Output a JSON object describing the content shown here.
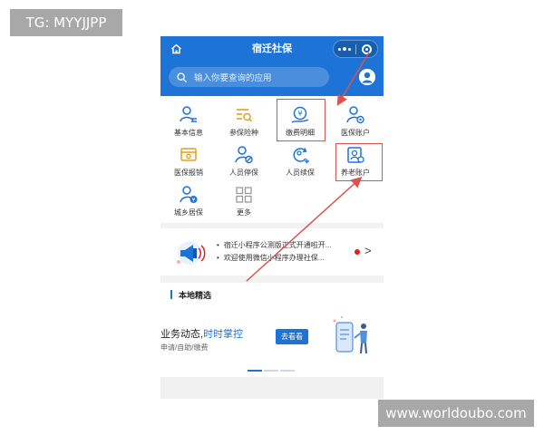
{
  "watermarks": {
    "top_left": "TG: MYYJJPP",
    "bottom_right": "www.worldoubo.com"
  },
  "header": {
    "title": "宿迁社保",
    "search_placeholder": "输入你要查询的应用",
    "icons": [
      "home-icon",
      "more-icon",
      "close-icon",
      "search-icon",
      "avatar-icon"
    ]
  },
  "grid": {
    "items": [
      {
        "label": "基本信息",
        "icon": "person-card-icon",
        "color": "#1d73d6"
      },
      {
        "label": "参保险种",
        "icon": "list-search-icon",
        "color": "#e0a020"
      },
      {
        "label": "缴费明细",
        "icon": "yuan-coin-icon",
        "color": "#1d73d6"
      },
      {
        "label": "医保账户",
        "icon": "person-shield-icon",
        "color": "#1d73d6"
      },
      {
        "label": "医保报销",
        "icon": "wallet-card-icon",
        "color": "#e0a020"
      },
      {
        "label": "人员停保",
        "icon": "person-stop-icon",
        "color": "#1d73d6"
      },
      {
        "label": "人员续保",
        "icon": "person-renew-icon",
        "color": "#1d73d6"
      },
      {
        "label": "养老账户",
        "icon": "person-account-icon",
        "color": "#1d73d6"
      },
      {
        "label": "城乡居保",
        "icon": "person-money-icon",
        "color": "#1d73d6"
      },
      {
        "label": "更多",
        "icon": "grid-more-icon",
        "color": "#999999"
      }
    ]
  },
  "notice": {
    "lines": [
      "宿迁小程序公测版正式开通啦开...",
      "欢迎使用微信小程序办理社保..."
    ],
    "chevron": ">",
    "icon": "megaphone-icon"
  },
  "local": {
    "section_title": "本地精选",
    "banner_title_prefix": "业务动态,",
    "banner_title_accent": "时时掌控",
    "banner_subtitle": "申请/自助/缴费",
    "banner_button": "去看看"
  },
  "colors": {
    "primary": "#1d73d6",
    "highlight": "#d9534f",
    "accent_gold": "#e0a020"
  }
}
